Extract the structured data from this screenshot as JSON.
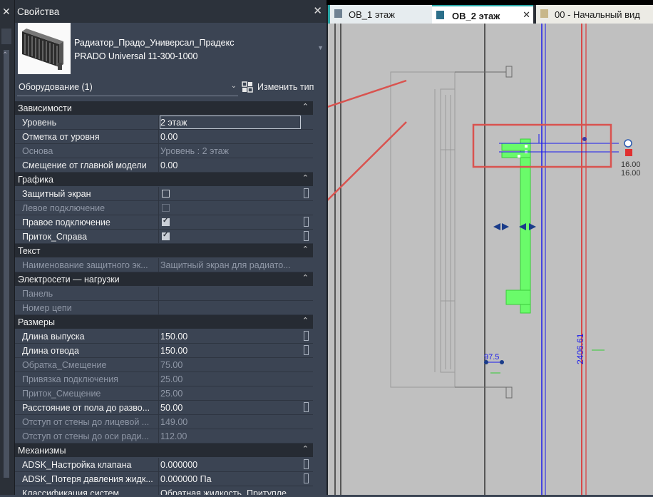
{
  "left_strip": {
    "close_glyph": "✕",
    "scroll_up_glyph": "⌃"
  },
  "panel": {
    "title": "Свойства",
    "close_glyph": "✕",
    "type_family": "Радиатор_Прадо_Универсал_Прадекс",
    "type_name": "PRADO Universal 11-300-1000",
    "category_select": "Оборудование (1)",
    "edit_type_label": "Изменить тип"
  },
  "groups": [
    {
      "name": "Зависимости",
      "rows": [
        {
          "label": "Уровень",
          "value": "2 этаж",
          "dim": false,
          "editing": true
        },
        {
          "label": "Отметка от уровня",
          "value": "0.00",
          "dim": false
        },
        {
          "label": "Основа",
          "value": "Уровень : 2 этаж",
          "dim": true
        },
        {
          "label": "Смещение от главной модели",
          "value": "0.00",
          "dim": false
        }
      ]
    },
    {
      "name": "Графика",
      "rows": [
        {
          "label": "Защитный экран",
          "checkbox": false,
          "dim": false,
          "param": true
        },
        {
          "label": "Левое подключение",
          "checkbox": false,
          "dim": true,
          "disabled": true
        },
        {
          "label": "Правое подключение",
          "checkbox": true,
          "dim": false,
          "param": true
        },
        {
          "label": "Приток_Справа",
          "checkbox": true,
          "dim": false,
          "param": true
        }
      ]
    },
    {
      "name": "Текст",
      "rows": [
        {
          "label": "Наименование защитного эк...",
          "value": "Защитный экран для радиато...",
          "dim": true
        }
      ]
    },
    {
      "name": "Электросети — нагрузки",
      "rows": [
        {
          "label": "Панель",
          "value": "",
          "dim": true
        },
        {
          "label": "Номер цепи",
          "value": "",
          "dim": true
        }
      ]
    },
    {
      "name": "Размеры",
      "rows": [
        {
          "label": "Длина выпуска",
          "value": "150.00",
          "dim": false,
          "param": true
        },
        {
          "label": "Длина отвода",
          "value": "150.00",
          "dim": false,
          "param": true
        },
        {
          "label": "Обратка_Смещение",
          "value": "75.00",
          "dim": true
        },
        {
          "label": "Привязка подключения",
          "value": "25.00",
          "dim": true
        },
        {
          "label": "Приток_Смещение",
          "value": "25.00",
          "dim": true
        },
        {
          "label": "Расстояние от пола до разво...",
          "value": "50.00",
          "dim": false,
          "param": true
        },
        {
          "label": "Отступ от стены до лицевой ...",
          "value": "149.00",
          "dim": true
        },
        {
          "label": "Отступ от стены до оси ради...",
          "value": "112.00",
          "dim": true
        }
      ]
    },
    {
      "name": "Механизмы",
      "rows": [
        {
          "label": "ADSK_Настройка клапана",
          "value": "0.000000",
          "dim": false,
          "param": true
        },
        {
          "label": "ADSK_Потеря давления жидк...",
          "value": "0.000000 Па",
          "dim": false,
          "param": true
        },
        {
          "label": "Классификация систем",
          "value": "Обратная жидкость, Притупле",
          "dim": false
        }
      ]
    }
  ],
  "tabs": [
    {
      "label": "ОВ_1 этаж"
    },
    {
      "label": "ОВ_2 этаж",
      "close_glyph": "✕"
    },
    {
      "label": "00 - Начальный вид"
    }
  ],
  "viewport": {
    "annotations": {
      "value_top": "16.00",
      "value_bottom": "16.00",
      "dimension_small": "97.5",
      "dimension_vertical": "2406.61"
    },
    "colors": {
      "background": "#c0c0c0",
      "selection_green": "#66ff66",
      "red_line": "#e02020",
      "blue_line": "#2020d0",
      "highlight_rect": "#d9534f",
      "arrow": "#d9534f"
    }
  },
  "icons": {
    "collapse": "⌃",
    "dropdown": "⌄"
  }
}
